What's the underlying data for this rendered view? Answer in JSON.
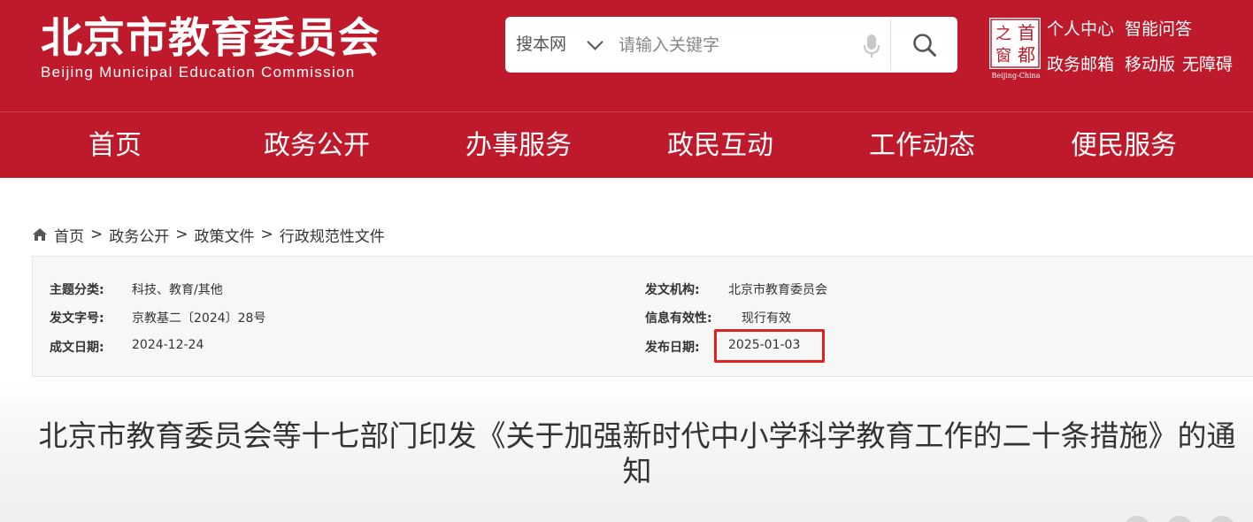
{
  "header": {
    "logo_cn": "北京市教育委员会",
    "logo_en": "Beijing Municipal Education Commission",
    "search_scope": "搜本网",
    "search_placeholder": "请输入关键字",
    "seal_chars": [
      "首",
      "都",
      "之",
      "窗"
    ],
    "seal_caption": "Beijing-China",
    "links_row1": [
      "个人中心",
      "智能问答"
    ],
    "links_row2": [
      "政务邮箱",
      "移动版",
      "无障碍"
    ]
  },
  "nav": [
    "首页",
    "政务公开",
    "办事服务",
    "政民互动",
    "工作动态",
    "便民服务"
  ],
  "breadcrumb": [
    "首页",
    "政务公开",
    "政策文件",
    "行政规范性文件"
  ],
  "info": {
    "topic_label": "主题分类:",
    "topic_value": "科技、教育/其他",
    "doc_no_label": "发文字号:",
    "doc_no_value": "京教基二〔2024〕28号",
    "created_label": "成文日期:",
    "created_value": "2024-12-24",
    "issuer_label": "发文机构:",
    "issuer_value": "北京市教育委员会",
    "validity_label": "信息有效性:",
    "validity_value": "现行有效",
    "published_label": "发布日期:",
    "published_value": "2025-01-03"
  },
  "doc_title": "北京市教育委员会等十七部门印发《关于加强新时代中小学科学教育工作的二十条措施》的通知",
  "colors": {
    "brand_red": "#bf1a2c",
    "highlight": "#e0221e"
  }
}
